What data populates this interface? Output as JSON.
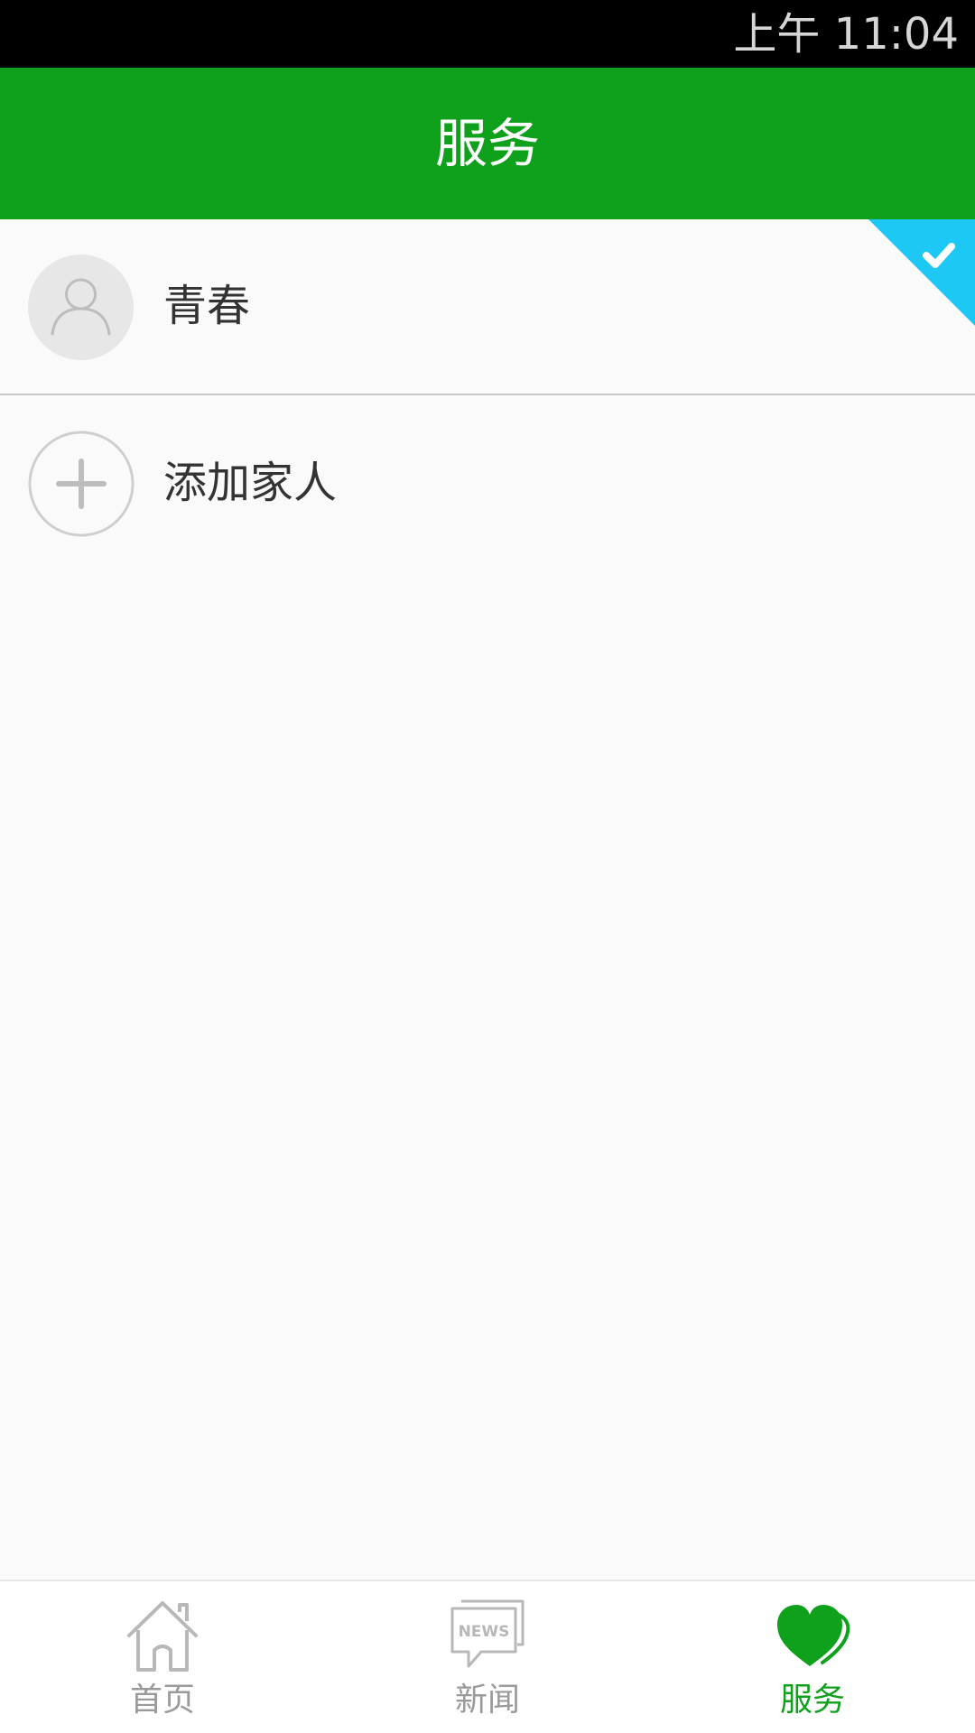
{
  "status_bar": {
    "time": "上午 11:04"
  },
  "header": {
    "title": "服务"
  },
  "members": [
    {
      "name": "青春",
      "selected": true,
      "avatar_icon": "person-outline-icon"
    }
  ],
  "add_member": {
    "label": "添加家人",
    "icon": "plus-circle-icon"
  },
  "bottom_nav": {
    "items": [
      {
        "label": "首页",
        "icon": "home-icon",
        "active": false
      },
      {
        "label": "新闻",
        "icon": "news-icon",
        "icon_text": "NEWS",
        "active": false
      },
      {
        "label": "服务",
        "icon": "heart-icon",
        "active": true
      }
    ]
  },
  "colors": {
    "status_bar": "#000000",
    "primary_green": "#0fa01c",
    "selected_badge": "#1ec8f5",
    "background": "#fafafa",
    "inactive_nav": "#9a9a9a",
    "text": "#333333"
  }
}
